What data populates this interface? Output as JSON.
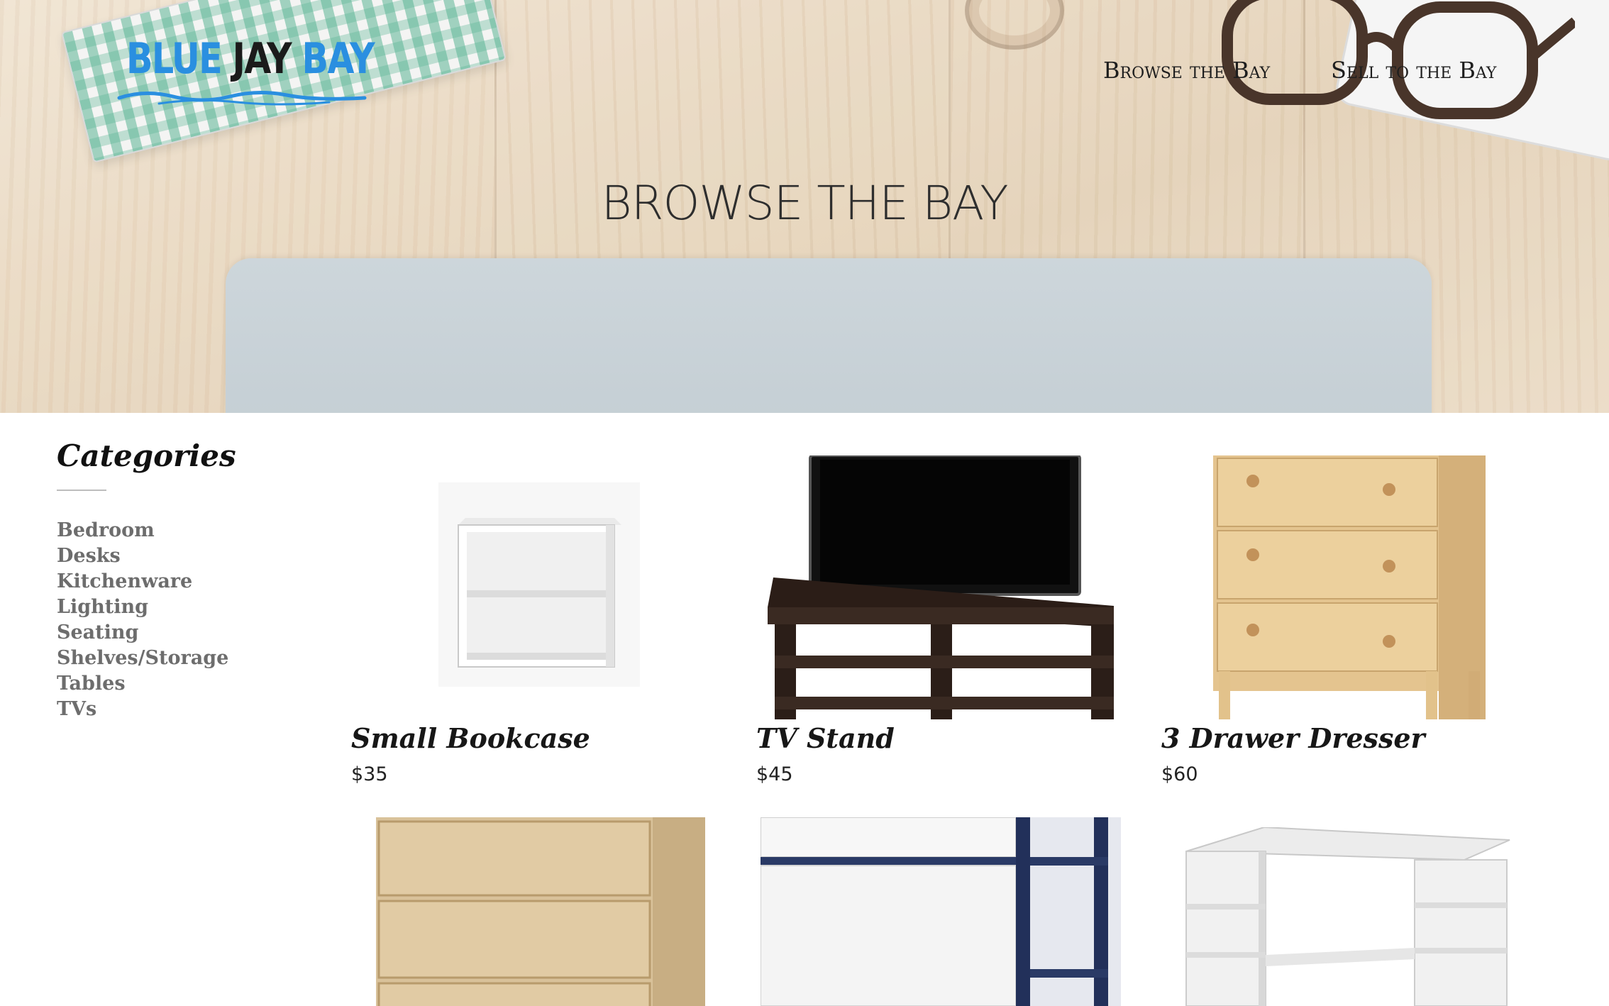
{
  "brand": {
    "logo_part1": "BLUE ",
    "logo_part2": "JAY ",
    "logo_part3": "BAY",
    "accent_color": "#2a8fe0"
  },
  "nav": {
    "items": [
      {
        "label": "Browse the Bay"
      },
      {
        "label": "Sell to the Bay"
      }
    ]
  },
  "hero": {
    "title": "BROWSE THE BAY"
  },
  "sidebar": {
    "title": "Categories",
    "items": [
      {
        "label": "Bedroom"
      },
      {
        "label": "Desks"
      },
      {
        "label": "Kitchenware"
      },
      {
        "label": "Lighting"
      },
      {
        "label": "Seating"
      },
      {
        "label": "Shelves/Storage"
      },
      {
        "label": "Tables"
      },
      {
        "label": "TVs"
      }
    ]
  },
  "products": [
    {
      "name": "Small Bookcase",
      "price": "$35",
      "icon": "bookcase-image"
    },
    {
      "name": "TV Stand",
      "price": "$45",
      "icon": "tv-stand-image"
    },
    {
      "name": "3 Drawer Dresser",
      "price": "$60",
      "icon": "dresser-image"
    },
    {
      "name": "",
      "price": "",
      "icon": "wood-dresser-image"
    },
    {
      "name": "",
      "price": "",
      "icon": "plastic-drawers-image"
    },
    {
      "name": "",
      "price": "",
      "icon": "corner-desk-image"
    }
  ]
}
